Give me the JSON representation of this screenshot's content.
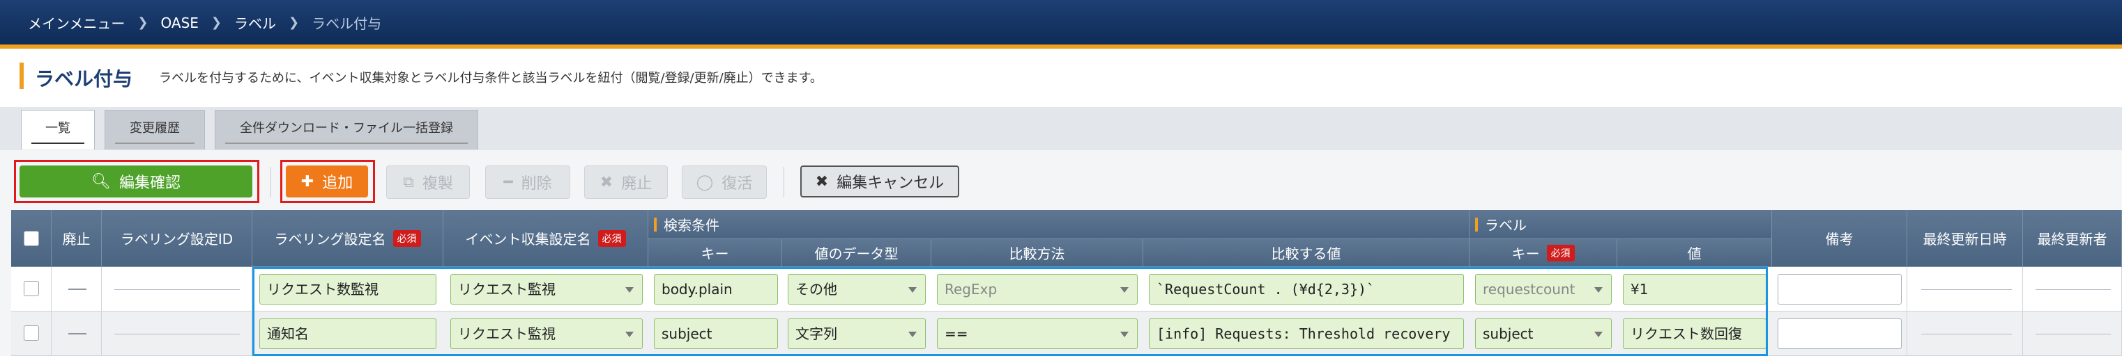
{
  "breadcrumb": [
    "メインメニュー",
    "OASE",
    "ラベル",
    "ラベル付与"
  ],
  "page": {
    "title": "ラベル付与",
    "description": "ラベルを付与するために、イベント収集対象とラベル付与条件と該当ラベルを紐付（閲覧/登録/更新/廃止）できます。"
  },
  "tabs": [
    "一覧",
    "変更履歴",
    "全件ダウンロード・ファイル一括登録"
  ],
  "toolbar": {
    "confirm": "編集確認",
    "add": "追加",
    "duplicate": "複製",
    "delete": "削除",
    "discard": "廃止",
    "restore": "復活",
    "cancel_edit": "編集キャンセル"
  },
  "table": {
    "headers": {
      "discard": "廃止",
      "id": "ラベリング設定ID",
      "name": "ラベリング設定名",
      "event": "イベント収集設定名",
      "search_group": "検索条件",
      "key": "キー",
      "dtype": "値のデータ型",
      "method": "比較方法",
      "compare_value": "比較する値",
      "label_group": "ラベル",
      "label_key": "キー",
      "label_value": "値",
      "remarks": "備考",
      "updated_at": "最終更新日時",
      "updated_by": "最終更新者"
    },
    "required_badge": "必須",
    "rows": [
      {
        "name": "リクエスト数監視",
        "event": "リクエスト監視",
        "key": "body.plain",
        "dtype": "その他",
        "method": "RegExp",
        "compare_value": "`RequestCount . (¥d{2,3})`",
        "label_key": "requestcount",
        "label_value": "¥1",
        "remarks": ""
      },
      {
        "name": "通知名",
        "event": "リクエスト監視",
        "key": "subject",
        "dtype": "文字列",
        "method": "==",
        "compare_value": "[info] Requests: Threshold recovery",
        "label_key": "subject",
        "label_value": "リクエスト数回復",
        "remarks": ""
      }
    ]
  },
  "colors": {
    "header_bar": "#1d3f73",
    "accent": "#f0a020",
    "confirm_button": "#4ea22a",
    "add_button": "#f07a1a",
    "highlight_red": "#e11b1b",
    "highlight_blue": "#1a96e0"
  }
}
